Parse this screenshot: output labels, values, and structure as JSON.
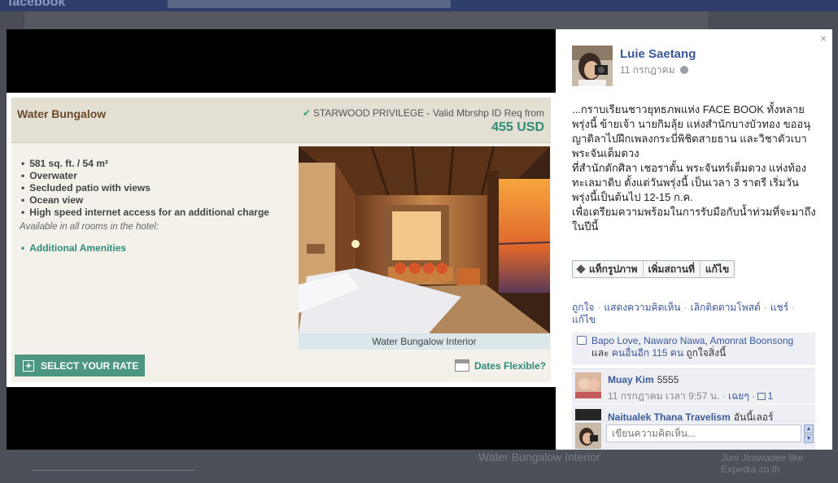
{
  "backdrop": {
    "logo_text": "facebook",
    "caption": "Water Bungalow Interior",
    "side_text": "Juni Jirawadee like Expedia.co.th"
  },
  "listing": {
    "title": "Water Bungalow",
    "privilege": "STARWOOD PRIVILEGE - Valid Mbrshp ID Req from",
    "price": "455 USD",
    "features": [
      "581 sq. ft. / 54 m²",
      "Overwater",
      "Secluded patio with views",
      "Ocean view",
      "High speed internet access for an additional charge"
    ],
    "availability_note": "Available in all rooms in the hotel:",
    "amenities_link": "Additional Amenities",
    "photo_caption": "Water Bungalow Interior",
    "select_rate_label": "SELECT YOUR RATE",
    "dates_flexible_label": "Dates Flexible?"
  },
  "post": {
    "close_glyph": "×",
    "author": "Luie Saetang",
    "date": "11 กรกฎาคม",
    "body_lines": [
      "...กราบเรียนชาวยุทธภพแห่ง FACE BOOK ทั้งหลาย",
      "พรุ่งนี้ ข้ายเจ้า นายกิมลุ้ย แห่งสำนักบางบัวทอง ขออนุญาติลาไปฝึกเพลงกระบี่พิชิตสายธาน และวิชาตัวเบาพระจันเต็มดวง",
      "ที่สำนักตักศิลา เชอราตั้น พระจันทร์เต็มดวง แห่งท้องทะเลมาดิบ ตั้งแต่วันพรุ่งนี้ เป็นเวลา 3 ราตรี เริ่มวันพรุ่งนี้เป็นต้นไป 12-15 ก.ค.",
      "เพื่อเตรียมความพร้อมในการรับมือกับน้ำท่วมที่จะมาถึงในปีนี้"
    ],
    "actions": {
      "tag_photo": "แท็กรูปภาพ",
      "add_location": "เพิ่มสถานที่",
      "edit": "แก้ไข"
    },
    "links": {
      "like": "ถูกใจ",
      "comment": "แสดงความคิดเห็น",
      "unfollow": "เลิกติดตามโพสต์",
      "share": "แชร์",
      "edit": "แก้ไข"
    },
    "likes": {
      "people": [
        "Bapo Love",
        "Nawaro Nawa",
        "Amonrat Boonsong"
      ],
      "and_text": "และ",
      "others": "คนอื่นอีก 115 คน",
      "suffix": "ถูกใจสิ่งนี้"
    },
    "comments": [
      {
        "author": "Muay Kim",
        "text": "5555",
        "time": "11 กรกฎาคม เวลา 9:57 น.",
        "reply": "เฉยๆ",
        "like_count": "1"
      },
      {
        "author": "Naitualek Thana Travelism",
        "text": "อันนี้เลอร์"
      }
    ],
    "composer_placeholder": "เขียนความคิดเห็น..."
  }
}
